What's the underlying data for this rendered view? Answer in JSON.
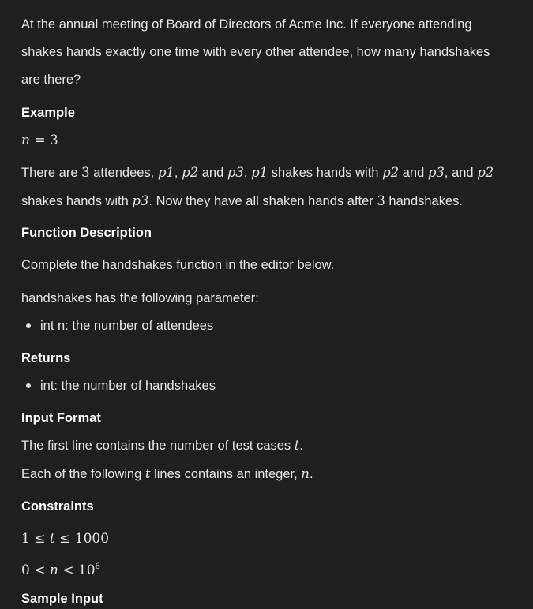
{
  "intro": {
    "text": "At the annual meeting of Board of Directors of Acme Inc. If everyone attending shakes hands exactly one time with every other attendee, how many handshakes are there?"
  },
  "example": {
    "heading": "Example",
    "math_var": "n",
    "math_op": " = ",
    "math_val": "3",
    "expl": {
      "t1": "There are ",
      "n1": "3",
      "t2": " attendees, ",
      "p1a": "p1",
      "t3": ", ",
      "p2a": "p2",
      "t4": " and ",
      "p3a": "p3",
      "t5": ". ",
      "p1b": "p1",
      "t6": " shakes hands with ",
      "p2b": "p2",
      "t7": " and ",
      "p3b": "p3",
      "t8": ", and ",
      "p2c": "p2",
      "t9": " shakes hands with ",
      "p3c": "p3",
      "t10": ". Now they have all shaken hands after ",
      "n2": "3",
      "t11": " handshakes."
    }
  },
  "function_description": {
    "heading": "Function Description",
    "text1": "Complete the handshakes function in the editor below.",
    "text2": "handshakes has the following parameter:",
    "params": [
      "int n: the number of attendees"
    ]
  },
  "returns": {
    "heading": "Returns",
    "items": [
      "int: the number of handshakes"
    ]
  },
  "input_format": {
    "heading": "Input Format",
    "line1_pre": "The first line contains the number of test cases ",
    "line1_var": "t",
    "line1_post": ".",
    "line2_pre": "Each of the following ",
    "line2_var": "t",
    "line2_mid": " lines contains an integer, ",
    "line2_var2": "n",
    "line2_post": "."
  },
  "constraints": {
    "heading": "Constraints",
    "c1": {
      "a": "1",
      "op1": " ≤ ",
      "v": "t",
      "op2": " ≤ ",
      "b": "1000"
    },
    "c2": {
      "a": "0",
      "op1": " < ",
      "v": "n",
      "op2": " < ",
      "b": "10",
      "exp": "6"
    }
  },
  "sample_input": {
    "heading": "Sample Input"
  }
}
